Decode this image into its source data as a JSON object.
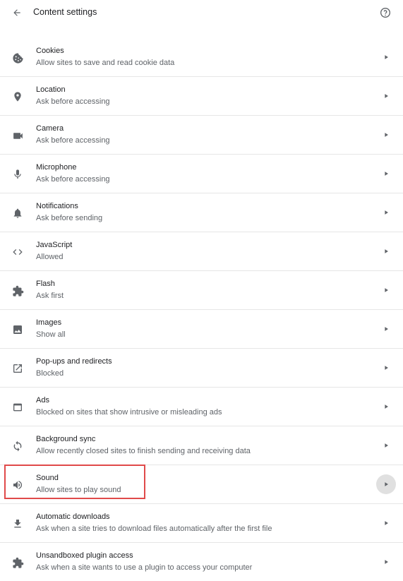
{
  "header": {
    "title": "Content settings",
    "back_icon": "arrow-back-icon",
    "help_icon": "help-icon"
  },
  "items": [
    {
      "key": "cookies",
      "title": "Cookies",
      "subtitle": "Allow sites to save and read cookie data",
      "icon": "cookie-icon"
    },
    {
      "key": "location",
      "title": "Location",
      "subtitle": "Ask before accessing",
      "icon": "location-pin-icon"
    },
    {
      "key": "camera",
      "title": "Camera",
      "subtitle": "Ask before accessing",
      "icon": "camera-icon"
    },
    {
      "key": "microphone",
      "title": "Microphone",
      "subtitle": "Ask before accessing",
      "icon": "microphone-icon"
    },
    {
      "key": "notifications",
      "title": "Notifications",
      "subtitle": "Ask before sending",
      "icon": "bell-icon"
    },
    {
      "key": "javascript",
      "title": "JavaScript",
      "subtitle": "Allowed",
      "icon": "code-icon"
    },
    {
      "key": "flash",
      "title": "Flash",
      "subtitle": "Ask first",
      "icon": "puzzle-icon"
    },
    {
      "key": "images",
      "title": "Images",
      "subtitle": "Show all",
      "icon": "image-icon"
    },
    {
      "key": "popups",
      "title": "Pop-ups and redirects",
      "subtitle": "Blocked",
      "icon": "open-in-new-icon"
    },
    {
      "key": "ads",
      "title": "Ads",
      "subtitle": "Blocked on sites that show intrusive or misleading ads",
      "icon": "window-icon"
    },
    {
      "key": "background-sync",
      "title": "Background sync",
      "subtitle": "Allow recently closed sites to finish sending and receiving data",
      "icon": "sync-icon"
    },
    {
      "key": "sound",
      "title": "Sound",
      "subtitle": "Allow sites to play sound",
      "icon": "volume-icon",
      "highlighted": true,
      "hover": true
    },
    {
      "key": "automatic-downloads",
      "title": "Automatic downloads",
      "subtitle": "Ask when a site tries to download files automatically after the first file",
      "icon": "download-icon"
    },
    {
      "key": "unsandboxed-plugins",
      "title": "Unsandboxed plugin access",
      "subtitle": "Ask when a site wants to use a plugin to access your computer",
      "icon": "puzzle-icon"
    }
  ],
  "colors": {
    "icon": "#5f6368",
    "highlight_border": "#e04a4a",
    "hover_circle": "#e0e0e0"
  }
}
